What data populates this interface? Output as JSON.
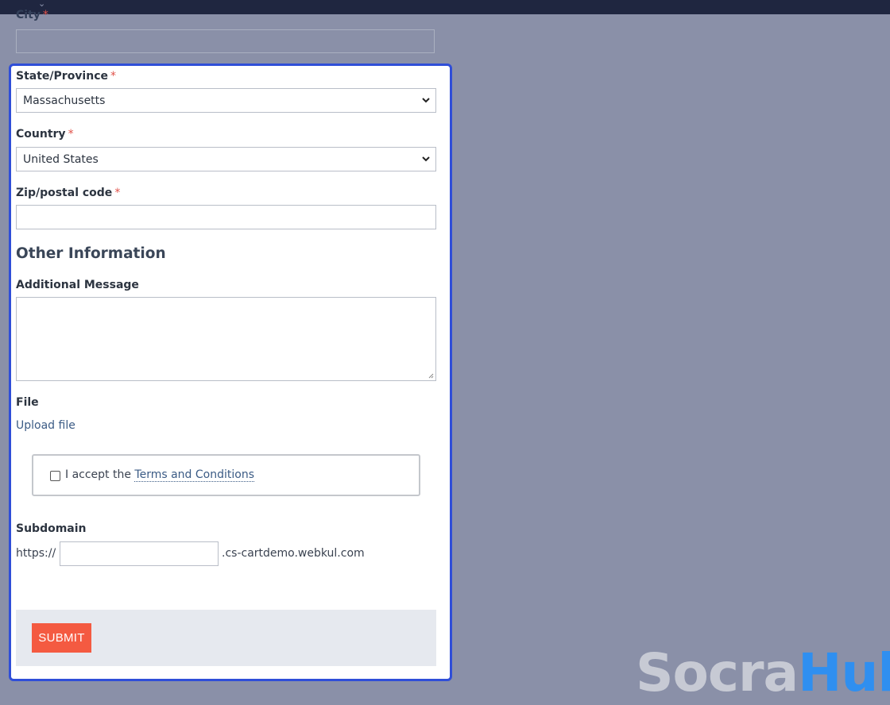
{
  "top": {
    "chevron": "⌄"
  },
  "city": {
    "label": "City",
    "required_mark": "*",
    "value": ""
  },
  "form": {
    "state": {
      "label": "State/Province",
      "required_mark": "*",
      "value": "Massachusetts"
    },
    "country": {
      "label": "Country",
      "required_mark": "*",
      "value": "United States"
    },
    "zip": {
      "label": "Zip/postal code",
      "required_mark": "*",
      "value": ""
    },
    "section_title": "Other Information",
    "message": {
      "label": "Additional Message",
      "value": ""
    },
    "file": {
      "label": "File",
      "link": "Upload file"
    },
    "terms": {
      "prefix": "I accept the",
      "link": "Terms and Conditions",
      "checked": false
    },
    "subdomain": {
      "label": "Subdomain",
      "prefix": "https://",
      "value": "",
      "suffix": ".cs-cartdemo.webkul.com"
    },
    "submit_label": "SUBMIT"
  },
  "watermark": {
    "part1": "Socra",
    "part2": "Hub"
  },
  "colors": {
    "accent_border": "#2f4ed8",
    "submit": "#f45a41",
    "link": "#3b5b85",
    "required": "#e0524a"
  }
}
